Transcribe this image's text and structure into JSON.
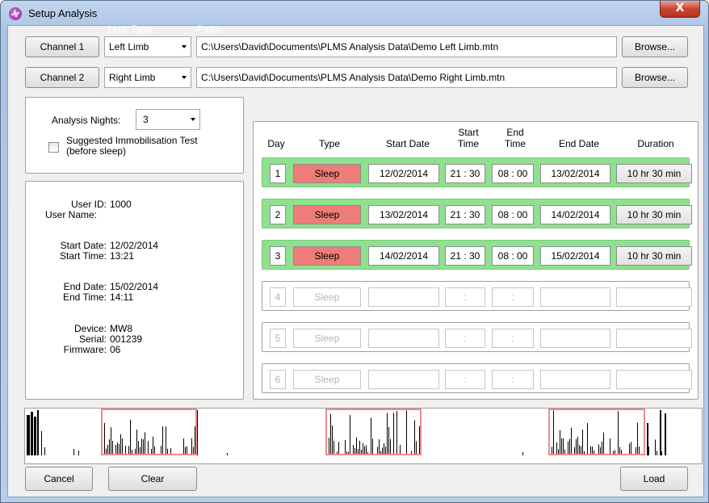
{
  "window": {
    "title": "Setup Analysis",
    "close_glyph": "X"
  },
  "labels": {
    "limb_type": "Limb Type:",
    "path": "Path:"
  },
  "channels": [
    {
      "button": "Channel 1",
      "limb": "Left Limb",
      "path": "C:\\Users\\David\\Documents\\PLMS Analysis Data\\Demo Left Limb.mtn",
      "browse": "Browse..."
    },
    {
      "button": "Channel 2",
      "limb": "Right Limb",
      "path": "C:\\Users\\David\\Documents\\PLMS Analysis Data\\Demo Right Limb.mtn",
      "browse": "Browse..."
    }
  ],
  "analysis": {
    "nights_label": "Analysis Nights:",
    "nights_value": "3",
    "immobilisation_label_1": "Suggested Immobilisation Test",
    "immobilisation_label_2": "(before sleep)",
    "immobilisation_checked": false
  },
  "info": {
    "user_id_label": "User ID:",
    "user_id": "1000",
    "user_name_label": "User Name:",
    "user_name": "",
    "start_date_label": "Start Date:",
    "start_date": "12/02/2014",
    "start_time_label": "Start Time:",
    "start_time": "13:21",
    "end_date_label": "End Date:",
    "end_date": "15/02/2014",
    "end_time_label": "End Time:",
    "end_time": "14:11",
    "device_label": "Device:",
    "device": "MW8",
    "serial_label": "Serial:",
    "serial": "001239",
    "firmware_label": "Firmware:",
    "firmware": "06"
  },
  "table_headers": {
    "day": "Day",
    "type": "Type",
    "start_date": "Start Date",
    "start_time_1": "Start",
    "start_time_2": "Time",
    "end_time_1": "End",
    "end_time_2": "Time",
    "end_date": "End Date",
    "duration": "Duration"
  },
  "days": [
    {
      "day": "1",
      "type": "Sleep",
      "start_date": "12/02/2014",
      "start_time": "21 : 30",
      "end_time": "08 : 00",
      "end_date": "13/02/2014",
      "duration": "10 hr 30 min",
      "active": true
    },
    {
      "day": "2",
      "type": "Sleep",
      "start_date": "13/02/2014",
      "start_time": "21 : 30",
      "end_time": "08 : 00",
      "end_date": "14/02/2014",
      "duration": "10 hr 30 min",
      "active": true
    },
    {
      "day": "3",
      "type": "Sleep",
      "start_date": "14/02/2014",
      "start_time": "21 : 30",
      "end_time": "08 : 00",
      "end_date": "15/02/2014",
      "duration": "10 hr 30 min",
      "active": true
    },
    {
      "day": "4",
      "type": "Sleep",
      "start_date": "",
      "start_time": ":",
      "end_time": ":",
      "end_date": "",
      "duration": "",
      "active": false
    },
    {
      "day": "5",
      "type": "Sleep",
      "start_date": "",
      "start_time": ":",
      "end_time": ":",
      "end_date": "",
      "duration": "",
      "active": false
    },
    {
      "day": "6",
      "type": "Sleep",
      "start_date": "",
      "start_time": ":",
      "end_time": ":",
      "end_date": "",
      "duration": "",
      "active": false
    }
  ],
  "buttons": {
    "cancel": "Cancel",
    "clear": "Clear",
    "load": "Load"
  },
  "colors": {
    "active_row": "#8fe08f",
    "sleep_cell": "#ee7c78",
    "selection": "#ee8a8a",
    "activity": "#000000"
  }
}
